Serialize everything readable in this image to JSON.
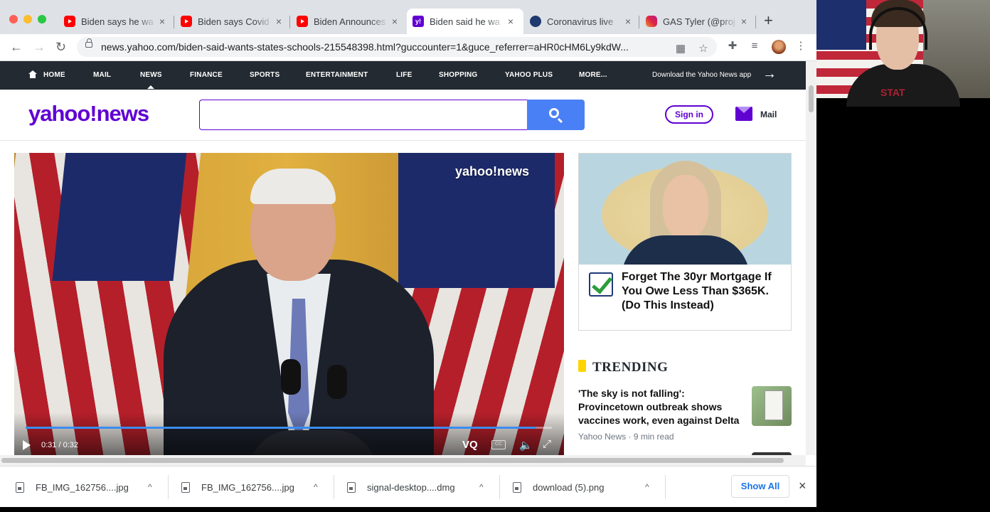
{
  "browser": {
    "tabs": [
      {
        "title": "Biden says he wa",
        "favicon": "youtube-icon",
        "active": false
      },
      {
        "title": "Biden says Covid",
        "favicon": "youtube-icon",
        "active": false
      },
      {
        "title": "Biden Announces",
        "favicon": "youtube-icon",
        "active": false
      },
      {
        "title": "Biden said he wa",
        "favicon": "yahoo-icon",
        "active": true
      },
      {
        "title": "Coronavirus live",
        "favicon": "cnn-icon",
        "active": false
      },
      {
        "title": "GAS Tyler (@proj",
        "favicon": "instagram-icon",
        "active": false
      }
    ],
    "tab_close_glyph": "×",
    "new_tab_glyph": "+",
    "url": "news.yahoo.com/biden-said-wants-states-schools-215548398.html?guccounter=1&guce_referrer=aHR0cHM6Ly9kdW...",
    "back_glyph": "←",
    "forward_glyph": "→",
    "reload_glyph": "↻",
    "menu_glyph": "⋮"
  },
  "yahoo_nav": {
    "items": [
      "HOME",
      "MAIL",
      "NEWS",
      "FINANCE",
      "SPORTS",
      "ENTERTAINMENT",
      "LIFE",
      "SHOPPING",
      "YAHOO PLUS",
      "MORE..."
    ],
    "app_link": "Download the Yahoo News app",
    "app_arrow": "→"
  },
  "header": {
    "logo": "yahoo!news",
    "search_placeholder": "",
    "signin": "Sign in",
    "mail": "Mail"
  },
  "video": {
    "watermark": "yahoo!news",
    "time": "0:31 / 0:32",
    "progress": 0.97,
    "vq": "VQ",
    "cc": "CC",
    "volume_glyph": "🔈",
    "fullscreen_glyph": "⤢"
  },
  "ad": {
    "headline": "Forget The 30yr Mortgage If You Owe Less Than $365K. (Do This Instead)"
  },
  "trending": {
    "title": "TRENDING",
    "headline": "'The sky is not falling': Provincetown outbreak shows vaccines work, even against Delta",
    "source": "Yahoo News",
    "time": "9 min read"
  },
  "downloads": {
    "items": [
      "FB_IMG_162756....jpg",
      "FB_IMG_162756....jpg",
      "signal-desktop....dmg",
      "download (5).png"
    ],
    "caret_glyph": "^",
    "show_all": "Show All",
    "close_glyph": "×"
  },
  "webcam": {
    "shirt_text": "STAT"
  },
  "colors": {
    "yahoo_purple": "#6001d2",
    "nav_dark": "#232a31",
    "search_blue": "#4a80f5",
    "progress_blue": "#3b8cf0",
    "trending_yellow": "#ffd400"
  }
}
